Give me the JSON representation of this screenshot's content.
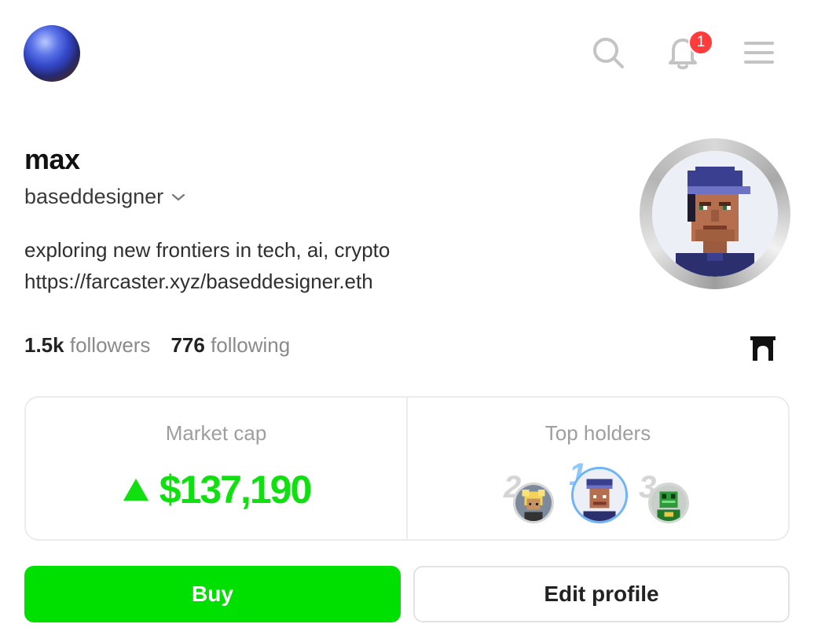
{
  "header": {
    "notifications_count": "1",
    "icons": [
      "search-icon",
      "bell-icon",
      "menu-icon"
    ]
  },
  "profile": {
    "display_name": "max",
    "handle": "baseddesigner",
    "bio_line1": "exploring new frontiers in tech, ai, crypto",
    "bio_link": "https://farcaster.xyz/baseddesigner.eth",
    "followers_count": "1.5k",
    "followers_label": "followers",
    "following_count": "776",
    "following_label": "following"
  },
  "card": {
    "market_cap_label": "Market cap",
    "market_cap_value": "$137,190",
    "market_cap_trend": "up",
    "top_holders_label": "Top holders",
    "holders": [
      {
        "rank": "2"
      },
      {
        "rank": "1"
      },
      {
        "rank": "3"
      }
    ]
  },
  "actions": {
    "buy_label": "Buy",
    "edit_label": "Edit profile"
  },
  "colors": {
    "accent_green": "#00e000",
    "badge_red": "#ff3b3b"
  }
}
